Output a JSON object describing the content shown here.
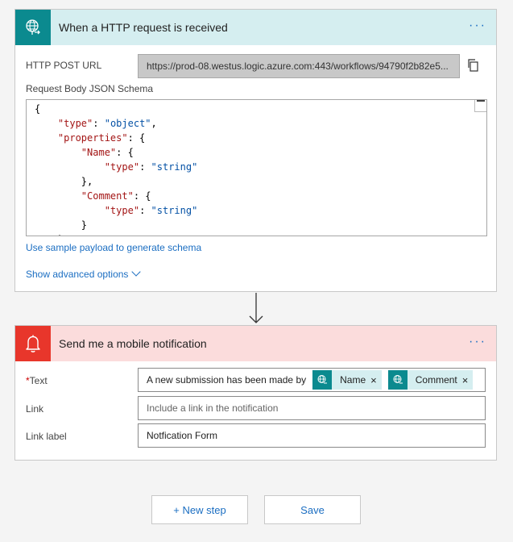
{
  "trigger": {
    "title": "When a HTTP request is received",
    "menu": "···",
    "url_label": "HTTP POST URL",
    "url_value": "https://prod-08.westus.logic.azure.com:443/workflows/94790f2b82e5...",
    "schema_label": "Request Body JSON Schema",
    "sample_link": "Use sample payload to generate schema",
    "advanced_link": "Show advanced options",
    "schema_lines": [
      {
        "indent": "",
        "parts": [
          [
            "p",
            "{"
          ]
        ]
      },
      {
        "indent": "    ",
        "parts": [
          [
            "k",
            "\"type\""
          ],
          [
            "p",
            ": "
          ],
          [
            "s",
            "\"object\""
          ],
          [
            "p",
            ","
          ]
        ]
      },
      {
        "indent": "    ",
        "parts": [
          [
            "k",
            "\"properties\""
          ],
          [
            "p",
            ": {"
          ]
        ]
      },
      {
        "indent": "        ",
        "parts": [
          [
            "k",
            "\"Name\""
          ],
          [
            "p",
            ": {"
          ]
        ]
      },
      {
        "indent": "            ",
        "parts": [
          [
            "k",
            "\"type\""
          ],
          [
            "p",
            ": "
          ],
          [
            "s",
            "\"string\""
          ]
        ]
      },
      {
        "indent": "        ",
        "parts": [
          [
            "p",
            "},"
          ]
        ]
      },
      {
        "indent": "        ",
        "parts": [
          [
            "k",
            "\"Comment\""
          ],
          [
            "p",
            ": {"
          ]
        ]
      },
      {
        "indent": "            ",
        "parts": [
          [
            "k",
            "\"type\""
          ],
          [
            "p",
            ": "
          ],
          [
            "s",
            "\"string\""
          ]
        ]
      },
      {
        "indent": "        ",
        "parts": [
          [
            "p",
            "}"
          ]
        ]
      },
      {
        "indent": "    ",
        "parts": [
          [
            "p",
            "},"
          ]
        ]
      }
    ]
  },
  "action": {
    "title": "Send me a mobile notification",
    "menu": "···",
    "text_label": "Text",
    "required_mark": "*",
    "text_prefix": "A new submission has been made by",
    "tokens": [
      "Name",
      "Comment"
    ],
    "token_close": "×",
    "link_label": "Link",
    "link_placeholder": "Include a link in the notification",
    "link_label_label": "Link label",
    "link_label_value": "Notfication Form"
  },
  "footer": {
    "new_step": "+ New step",
    "save": "Save"
  },
  "colors": {
    "trigger_accent": "#0b8a8f",
    "trigger_header": "#d5eef0",
    "action_accent": "#e8362b",
    "action_header": "#fbdcdc",
    "link": "#1b6ec2"
  }
}
